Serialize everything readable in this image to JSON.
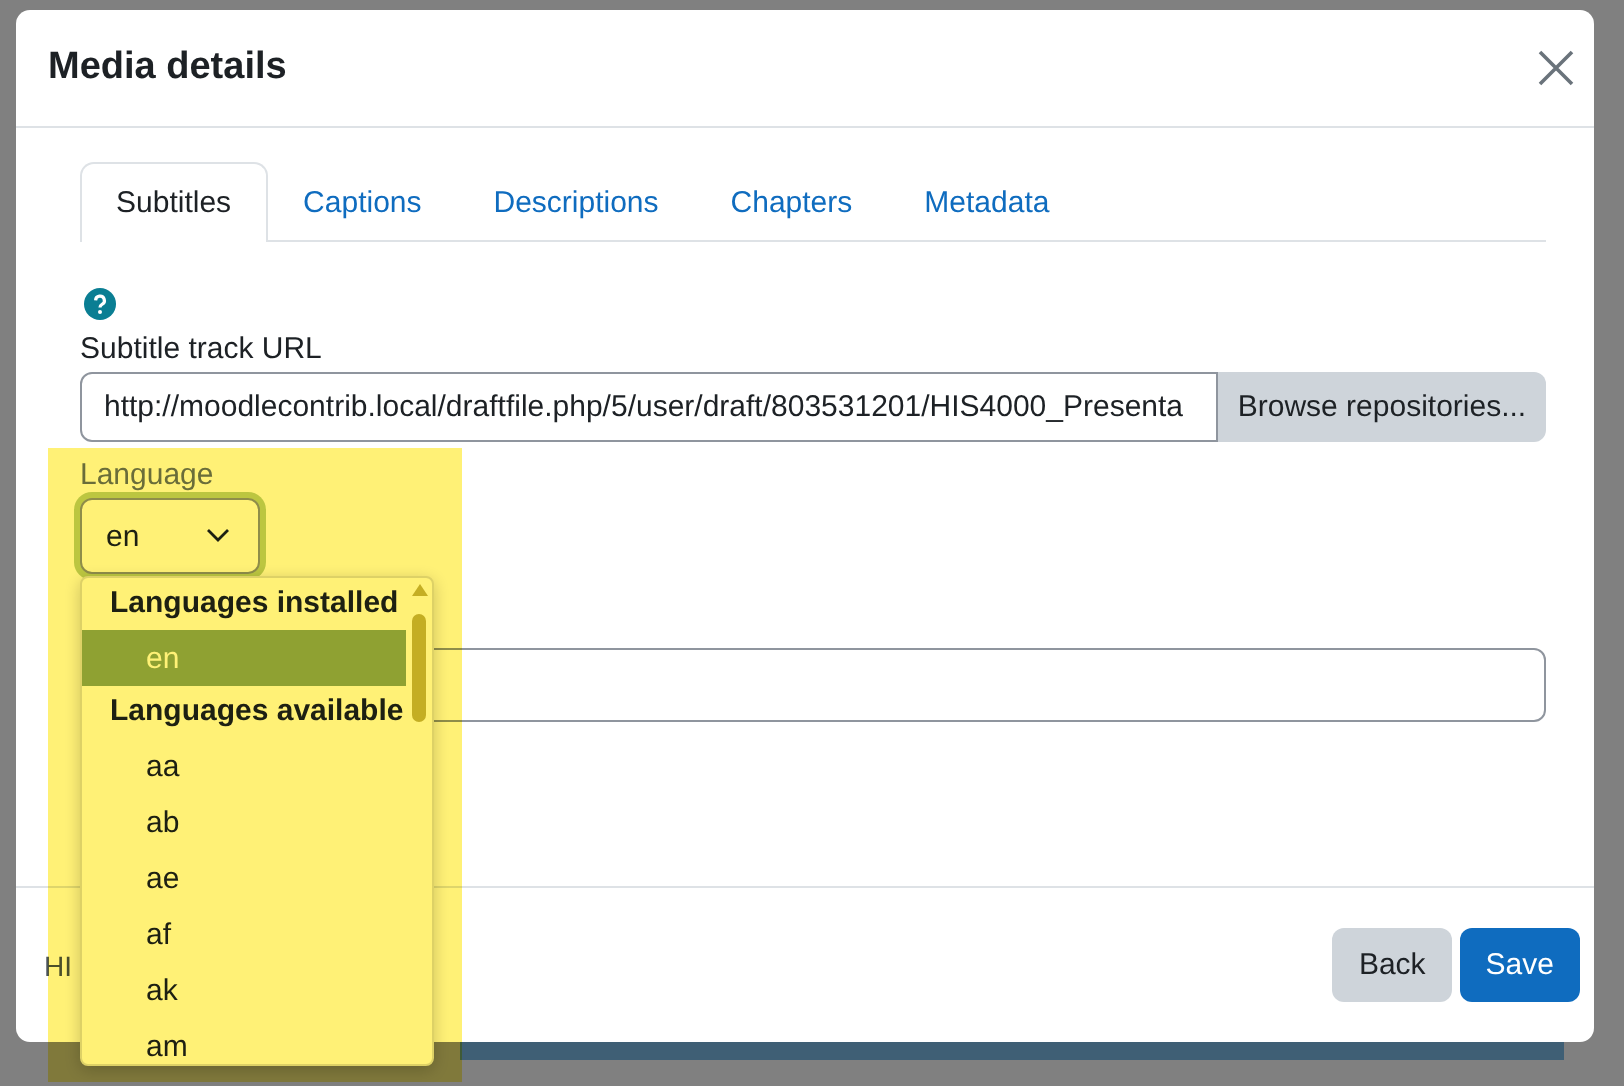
{
  "dialog": {
    "title": "Media details"
  },
  "tabs": [
    {
      "label": "Subtitles",
      "selected": true
    },
    {
      "label": "Captions",
      "selected": false
    },
    {
      "label": "Descriptions",
      "selected": false
    },
    {
      "label": "Chapters",
      "selected": false
    },
    {
      "label": "Metadata",
      "selected": false
    }
  ],
  "url_field": {
    "label": "Subtitle track URL",
    "value": "http://moodlecontrib.local/draftfile.php/5/user/draft/803531201/HIS4000_Presenta",
    "button": "Browse repositories..."
  },
  "language": {
    "label": "Language",
    "value": "en",
    "groups": [
      {
        "label": "Languages installed",
        "options": [
          {
            "label": "en",
            "selected": true
          }
        ]
      },
      {
        "label": "Languages available",
        "options": [
          {
            "label": "aa",
            "selected": false
          },
          {
            "label": "ab",
            "selected": false
          },
          {
            "label": "ae",
            "selected": false
          },
          {
            "label": "af",
            "selected": false
          },
          {
            "label": "ak",
            "selected": false
          },
          {
            "label": "am",
            "selected": false
          }
        ]
      }
    ]
  },
  "footer": {
    "text": "HI",
    "buttons": [
      {
        "label": "Back",
        "kind": "secondary"
      },
      {
        "label": "Save",
        "kind": "primary"
      }
    ]
  }
}
